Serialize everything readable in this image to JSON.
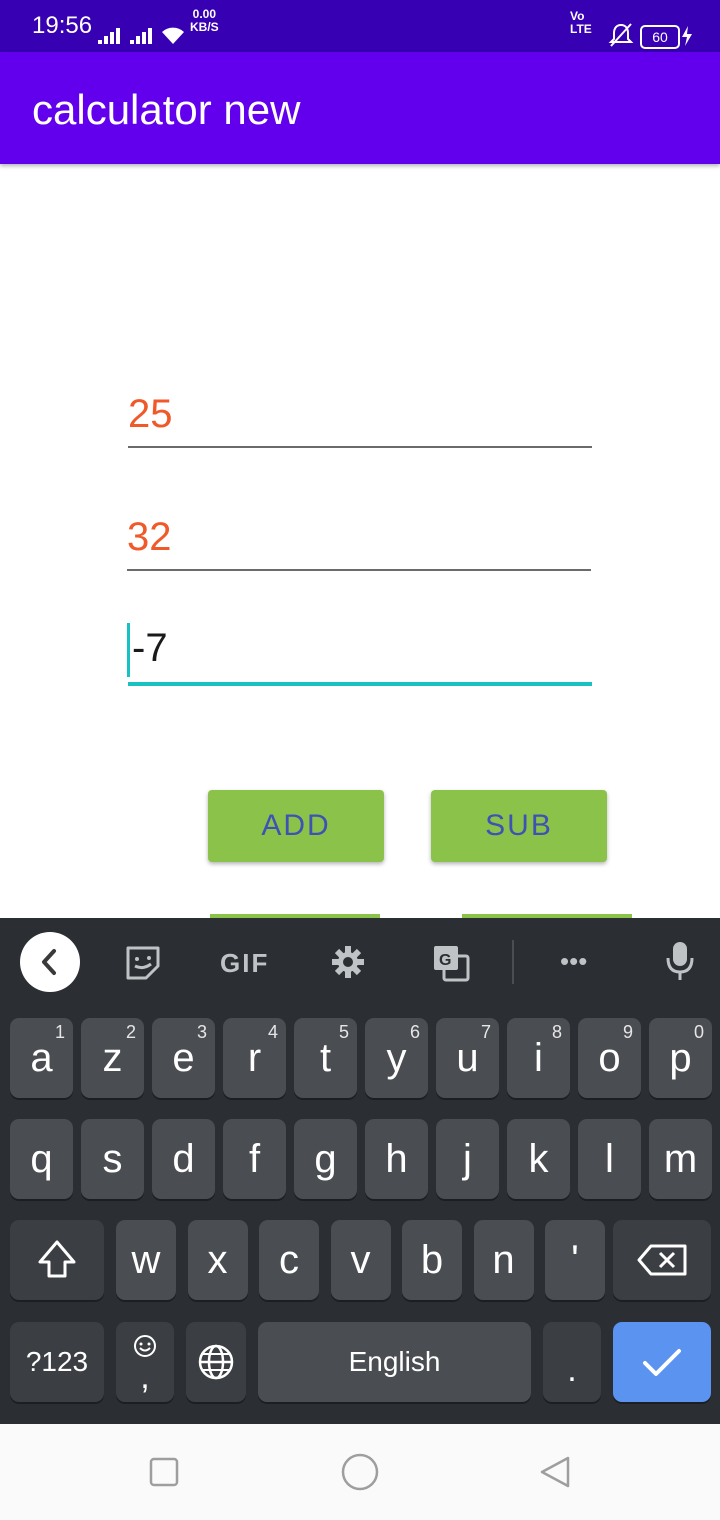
{
  "status_bar": {
    "time": "19:56",
    "speed_top": "0.00",
    "speed_bottom": "KB/S",
    "volte_top": "Vo",
    "volte_bottom": "LTE",
    "battery": "60"
  },
  "app_bar": {
    "title": "calculator new"
  },
  "fields": {
    "first": "25",
    "second": "32",
    "result": "-7"
  },
  "buttons": {
    "add": "ADD",
    "sub": "SUB"
  },
  "keyboard": {
    "toolbar": {
      "gif": "GIF",
      "more": "•••"
    },
    "row1": [
      {
        "k": "a",
        "s": "1"
      },
      {
        "k": "z",
        "s": "2"
      },
      {
        "k": "e",
        "s": "3"
      },
      {
        "k": "r",
        "s": "4"
      },
      {
        "k": "t",
        "s": "5"
      },
      {
        "k": "y",
        "s": "6"
      },
      {
        "k": "u",
        "s": "7"
      },
      {
        "k": "i",
        "s": "8"
      },
      {
        "k": "o",
        "s": "9"
      },
      {
        "k": "p",
        "s": "0"
      }
    ],
    "row2": [
      "q",
      "s",
      "d",
      "f",
      "g",
      "h",
      "j",
      "k",
      "l",
      "m"
    ],
    "row3": [
      "w",
      "x",
      "c",
      "v",
      "b",
      "n",
      "'"
    ],
    "symbols": "?123",
    "comma": ",",
    "space": "English",
    "period": "."
  }
}
